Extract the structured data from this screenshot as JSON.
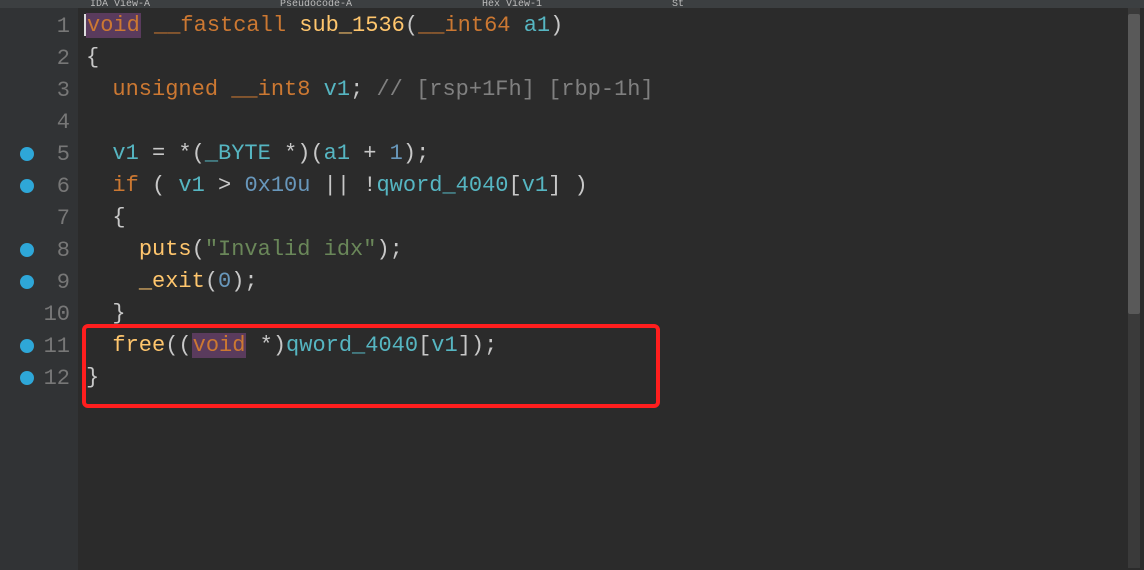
{
  "tabs": {
    "t1": "IDA View-A",
    "t2": "Pseudocode-A",
    "t3": "Hex View-1",
    "t4": "St"
  },
  "gutter": [
    {
      "n": "1",
      "bp": false
    },
    {
      "n": "2",
      "bp": false
    },
    {
      "n": "3",
      "bp": false
    },
    {
      "n": "4",
      "bp": false
    },
    {
      "n": "5",
      "bp": true
    },
    {
      "n": "6",
      "bp": true
    },
    {
      "n": "7",
      "bp": false
    },
    {
      "n": "8",
      "bp": true
    },
    {
      "n": "9",
      "bp": true
    },
    {
      "n": "10",
      "bp": false
    },
    {
      "n": "11",
      "bp": true
    },
    {
      "n": "12",
      "bp": true
    }
  ],
  "code": {
    "l1": {
      "void": "void",
      "fastcall": "__fastcall",
      "fn": "sub_1536",
      "int64": "__int64",
      "a1": "a1"
    },
    "l2": "{",
    "l3": {
      "unsigned": "unsigned",
      "int8": "__int8",
      "v1": "v1",
      "com": "// [rsp+1Fh] [rbp-1h]"
    },
    "l5": {
      "v1": "v1",
      "byte": "_BYTE",
      "a1": "a1",
      "one": "1"
    },
    "l6": {
      "if": "if",
      "v1": "v1",
      "hex": "0x10u",
      "arr": "qword_4040",
      "v1b": "v1"
    },
    "l7": "  {",
    "l8": {
      "puts": "puts",
      "str": "\"Invalid idx\""
    },
    "l9": {
      "exit": "_exit",
      "zero": "0"
    },
    "l10": "  }",
    "l11": {
      "free": "free",
      "void": "void",
      "arr": "qword_4040",
      "v1": "v1"
    },
    "l12": "}"
  }
}
